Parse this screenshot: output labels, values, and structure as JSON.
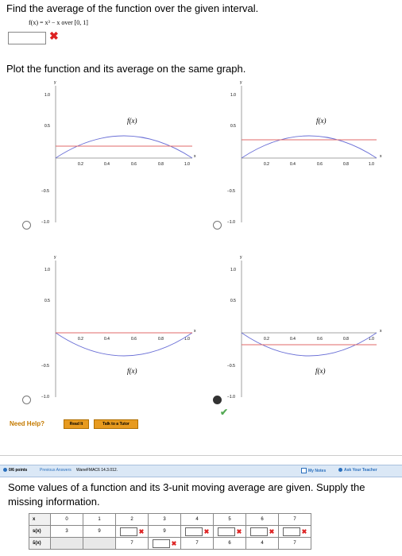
{
  "question1": {
    "title": "Find the average of the function over the given interval.",
    "function_text": "f(x) = x³ − x over [0, 1]",
    "answer_value": "",
    "plot_instruction": "Plot the function and its average on the same graph.",
    "need_help": "Need Help?",
    "read_it": "Read It",
    "talk_tutor": "Talk to a Tutor"
  },
  "graph_labels": {
    "y": "y",
    "x": "x",
    "fx": "f(x)",
    "xticks": [
      "0.2",
      "0.4",
      "0.6",
      "0.8",
      "1.0"
    ],
    "yticks": [
      "1.0",
      "0.5",
      "−0.5",
      "−1.0"
    ]
  },
  "chart_data": [
    {
      "type": "line",
      "position": "top-left",
      "x_range": [
        0,
        1
      ],
      "ylim": [
        -1,
        1
      ],
      "series": [
        {
          "name": "f(x)",
          "shape": "concave-down arch",
          "peak": 0.35
        },
        {
          "average": 0.2
        }
      ],
      "selected": false
    },
    {
      "type": "line",
      "position": "top-right",
      "x_range": [
        0,
        1
      ],
      "ylim": [
        -1,
        1
      ],
      "series": [
        {
          "name": "f(x)",
          "shape": "concave-down arch",
          "peak": 0.35
        },
        {
          "average": 0.35
        }
      ],
      "selected": false
    },
    {
      "type": "line",
      "position": "bottom-left",
      "x_range": [
        0,
        1
      ],
      "ylim": [
        -1,
        1
      ],
      "series": [
        {
          "name": "f(x)",
          "shape": "concave-up arch",
          "min": -0.38
        },
        {
          "average": 0.0
        }
      ],
      "selected": false
    },
    {
      "type": "line",
      "position": "bottom-right",
      "x_range": [
        0,
        1
      ],
      "ylim": [
        -1,
        1
      ],
      "series": [
        {
          "name": "f(x)",
          "shape": "concave-up arch",
          "min": -0.38
        },
        {
          "average": -0.25
        }
      ],
      "selected": true
    }
  ],
  "question2": {
    "points": "0/6 points",
    "prev_answers": "Previous Answers",
    "code": "WaneFMAC6 14.3.012.",
    "my_notes": "My Notes",
    "ask_teacher": "Ask Your Teacher",
    "text": "Some values of a function and its 3-unit moving average are given. Supply the missing information.",
    "row_labels": [
      "x",
      "s(x)",
      "s̄(x)"
    ],
    "x_values": [
      "0",
      "1",
      "2",
      "3",
      "4",
      "5",
      "6",
      "7"
    ],
    "s_values": [
      "3",
      "9",
      "",
      "9",
      "",
      "",
      "",
      ""
    ],
    "sbar_values": [
      "",
      "",
      "7",
      "",
      "7",
      "6",
      "4",
      "7"
    ]
  }
}
